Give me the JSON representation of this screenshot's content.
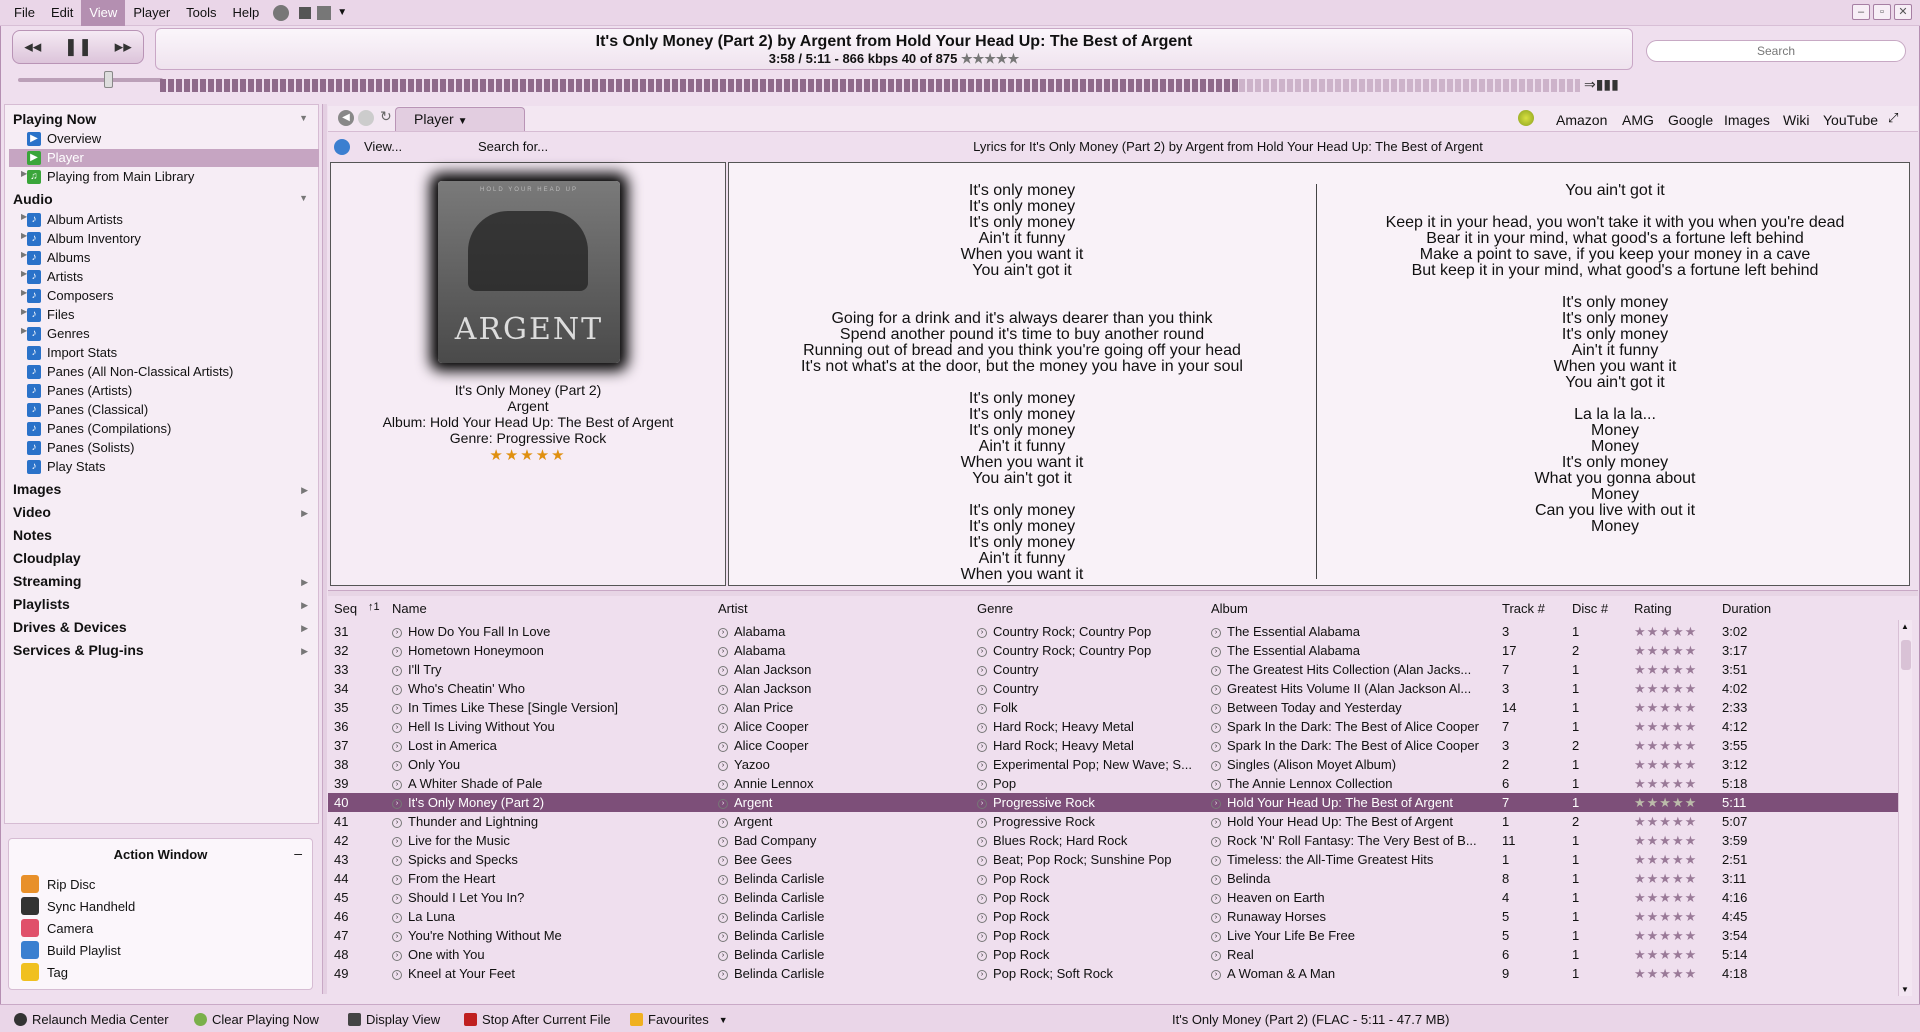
{
  "menu": [
    "File",
    "Edit",
    "View",
    "Player",
    "Tools",
    "Help"
  ],
  "now_playing": {
    "title_line": "It's Only Money (Part 2) by Argent from Hold Your Head Up: The Best of Argent",
    "info_line": "3:58 / 5:11 -  866 kbps   40 of 875",
    "rating": "★★★★★",
    "progress_fraction": 0.76
  },
  "search": {
    "placeholder": "Search"
  },
  "sidebar": {
    "playing_now": "Playing Now",
    "playing_items": [
      "Overview",
      "Player",
      "Playing from Main Library"
    ],
    "audio": "Audio",
    "audio_items": [
      "Album Artists",
      "Album Inventory",
      "Albums",
      "Artists",
      "Composers",
      "Files",
      "Genres",
      "Import Stats",
      "Panes (All Non-Classical Artists)",
      "Panes (Artists)",
      "Panes (Classical)",
      "Panes (Compilations)",
      "Panes (Solists)",
      "Play Stats"
    ],
    "sections": [
      "Images",
      "Video",
      "Notes",
      "Cloudplay",
      "Streaming",
      "Playlists",
      "Drives & Devices",
      "Services & Plug-ins"
    ]
  },
  "action_window": {
    "title": "Action Window",
    "items": [
      "Rip Disc",
      "Sync Handheld",
      "Camera",
      "Build Playlist",
      "Tag"
    ]
  },
  "tabs": {
    "player": "Player"
  },
  "links": [
    "Amazon",
    "AMG",
    "Google",
    "Images",
    "Wiki",
    "YouTube"
  ],
  "subbar": {
    "view": "View...",
    "search_for": "Search for...",
    "lyrics_title": "Lyrics for It's Only Money (Part 2) by Argent from Hold Your Head Up: The Best of Argent"
  },
  "album_art": {
    "word": "ARGENT",
    "tagline": "HOLD YOUR HEAD UP"
  },
  "track_info": {
    "name": "It's Only Money (Part 2)",
    "artist": "Argent",
    "album": "Album: Hold Your Head Up: The Best of Argent",
    "genre": "Genre: Progressive Rock",
    "stars": "★★★★★"
  },
  "lyrics_col1": [
    "It's only money",
    "It's only money",
    "It's only money",
    "Ain't it funny",
    "When you want it",
    "You ain't got it",
    "",
    "",
    "Going for a drink and it's always dearer than you think",
    "Spend another pound it's time to buy another round",
    "Running out of bread and you think you're going off your head",
    "It's not what's at the door, but the money you have in your soul",
    "",
    "It's only money",
    "It's only money",
    "It's only money",
    "Ain't it funny",
    "When you want it",
    "You ain't got it",
    "",
    "It's only money",
    "It's only money",
    "It's only money",
    "Ain't it funny",
    "When you want it"
  ],
  "lyrics_col2": [
    "You ain't got it",
    "",
    "Keep it in your head, you won't take it with you when you're dead",
    "Bear it in your mind, what good's a fortune left behind",
    "Make a point to save, if you keep your money in a cave",
    "But keep it in your mind, what good's a fortune left behind",
    "",
    "It's only money",
    "It's only money",
    "It's only money",
    "Ain't it funny",
    "When you want it",
    "You ain't got it",
    "",
    "La la la la...",
    "Money",
    "Money",
    "It's only money",
    "What you gonna about",
    "Money",
    "Can you live with out it",
    "Money"
  ],
  "columns": [
    "Seq",
    "Name",
    "Artist",
    "Genre",
    "Album",
    "Track #",
    "Disc #",
    "Rating",
    "Duration"
  ],
  "rows": [
    [
      "31",
      "How Do You Fall In Love",
      "Alabama",
      "Country Rock; Country Pop",
      "The Essential Alabama",
      "3",
      "1",
      "★★★★★",
      "3:02"
    ],
    [
      "32",
      "Hometown Honeymoon",
      "Alabama",
      "Country Rock; Country Pop",
      "The Essential Alabama",
      "17",
      "2",
      "★★★★★",
      "3:17"
    ],
    [
      "33",
      "I'll Try",
      "Alan Jackson",
      "Country",
      "The Greatest Hits Collection (Alan Jacks...",
      "7",
      "1",
      "★★★★★",
      "3:51"
    ],
    [
      "34",
      "Who's Cheatin' Who",
      "Alan Jackson",
      "Country",
      "Greatest Hits Volume II (Alan Jackson Al...",
      "3",
      "1",
      "★★★★★",
      "4:02"
    ],
    [
      "35",
      "In Times Like These [Single Version]",
      "Alan Price",
      "Folk",
      "Between Today and Yesterday",
      "14",
      "1",
      "★★★★★",
      "2:33"
    ],
    [
      "36",
      "Hell Is Living Without You",
      "Alice Cooper",
      "Hard Rock; Heavy Metal",
      "Spark In the Dark: The Best of Alice Cooper",
      "7",
      "1",
      "★★★★★",
      "4:12"
    ],
    [
      "37",
      "Lost in America",
      "Alice Cooper",
      "Hard Rock; Heavy Metal",
      "Spark In the Dark: The Best of Alice Cooper",
      "3",
      "2",
      "★★★★★",
      "3:55"
    ],
    [
      "38",
      "Only You",
      "Yazoo",
      "Experimental Pop; New Wave; S...",
      "Singles (Alison Moyet Album)",
      "2",
      "1",
      "★★★★★",
      "3:12"
    ],
    [
      "39",
      "A Whiter Shade of Pale",
      "Annie Lennox",
      "Pop",
      "The Annie Lennox Collection",
      "6",
      "1",
      "★★★★★",
      "5:18"
    ],
    [
      "40",
      "It's Only Money (Part 2)",
      "Argent",
      "Progressive Rock",
      "Hold Your Head Up: The Best of Argent",
      "7",
      "1",
      "★★★★★",
      "5:11"
    ],
    [
      "41",
      "Thunder and Lightning",
      "Argent",
      "Progressive Rock",
      "Hold Your Head Up: The Best of Argent",
      "1",
      "2",
      "★★★★★",
      "5:07"
    ],
    [
      "42",
      "Live for the Music",
      "Bad Company",
      "Blues Rock; Hard Rock",
      "Rock 'N' Roll Fantasy: The Very Best of B...",
      "11",
      "1",
      "★★★★★",
      "3:59"
    ],
    [
      "43",
      "Spicks and Specks",
      "Bee Gees",
      "Beat; Pop Rock; Sunshine Pop",
      "Timeless: the All-Time Greatest Hits",
      "1",
      "1",
      "★★★★★",
      "2:51"
    ],
    [
      "44",
      "From the Heart",
      "Belinda Carlisle",
      "Pop Rock",
      "Belinda",
      "8",
      "1",
      "★★★★★",
      "3:11"
    ],
    [
      "45",
      "Should I Let You In?",
      "Belinda Carlisle",
      "Pop Rock",
      "Heaven on Earth",
      "4",
      "1",
      "★★★★★",
      "4:16"
    ],
    [
      "46",
      "La Luna",
      "Belinda Carlisle",
      "Pop Rock",
      "Runaway Horses",
      "5",
      "1",
      "★★★★★",
      "4:45"
    ],
    [
      "47",
      "You're Nothing Without Me",
      "Belinda Carlisle",
      "Pop Rock",
      "Live Your Life Be Free",
      "5",
      "1",
      "★★★★★",
      "3:54"
    ],
    [
      "48",
      "One with You",
      "Belinda Carlisle",
      "Pop Rock",
      "Real",
      "6",
      "1",
      "★★★★★",
      "5:14"
    ],
    [
      "49",
      "Kneel at Your Feet",
      "Belinda Carlisle",
      "Pop Rock; Soft Rock",
      "A Woman & A Man",
      "9",
      "1",
      "★★★★★",
      "4:18"
    ]
  ],
  "selected_row": 9,
  "status": {
    "relaunch": "Relaunch Media Center",
    "clear": "Clear Playing Now",
    "display": "Display View",
    "stop": "Stop After Current File",
    "favourites": "Favourites",
    "file_info": "It's Only Money (Part 2) (FLAC - 5:11 - 47.7 MB)"
  }
}
